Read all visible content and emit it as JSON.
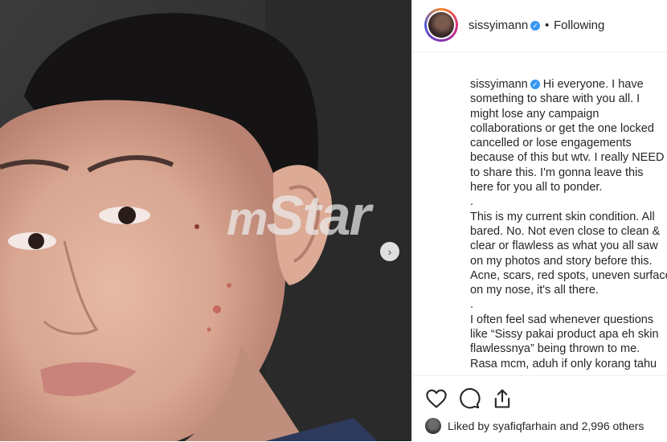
{
  "media": {
    "watermark_prefix": "m",
    "watermark_text": "Star",
    "next_button": "›"
  },
  "header": {
    "username": "sissyimann",
    "verified_mark": "✓",
    "separator": "•",
    "follow_status": "Following"
  },
  "caption": {
    "username": "sissyimann",
    "lines": [
      "Hi everyone. I have",
      "something to share with you all. I",
      "might lose any campaign",
      "collaborations or get the one locked",
      "cancelled or lose engagements",
      "because of this but wtv. I really NEED",
      "to share this. I'm gonna leave this",
      "here for you all to ponder.",
      ".",
      "This is my current skin condition. All",
      "bared. No. Not even close to clean &",
      "clear or flawless as what you all saw",
      "on my photos and story before this.",
      "Acne, scars, red spots, uneven surface",
      "on my nose, it's all there.",
      ".",
      "I often feel sad whenever questions",
      "like “Sissy pakai product apa eh skin",
      "flawlessnya” being thrown to me.",
      "Rasa mcm, aduh if only korang tahu"
    ]
  },
  "actions": {
    "like_icon": "heart-icon",
    "comment_icon": "comment-icon",
    "share_icon": "share-icon",
    "liked_by_prefix": "Liked by ",
    "liked_by_user": "syafiqfarhain",
    "liked_by_middle": " and ",
    "liked_by_count": "2,996 others"
  }
}
